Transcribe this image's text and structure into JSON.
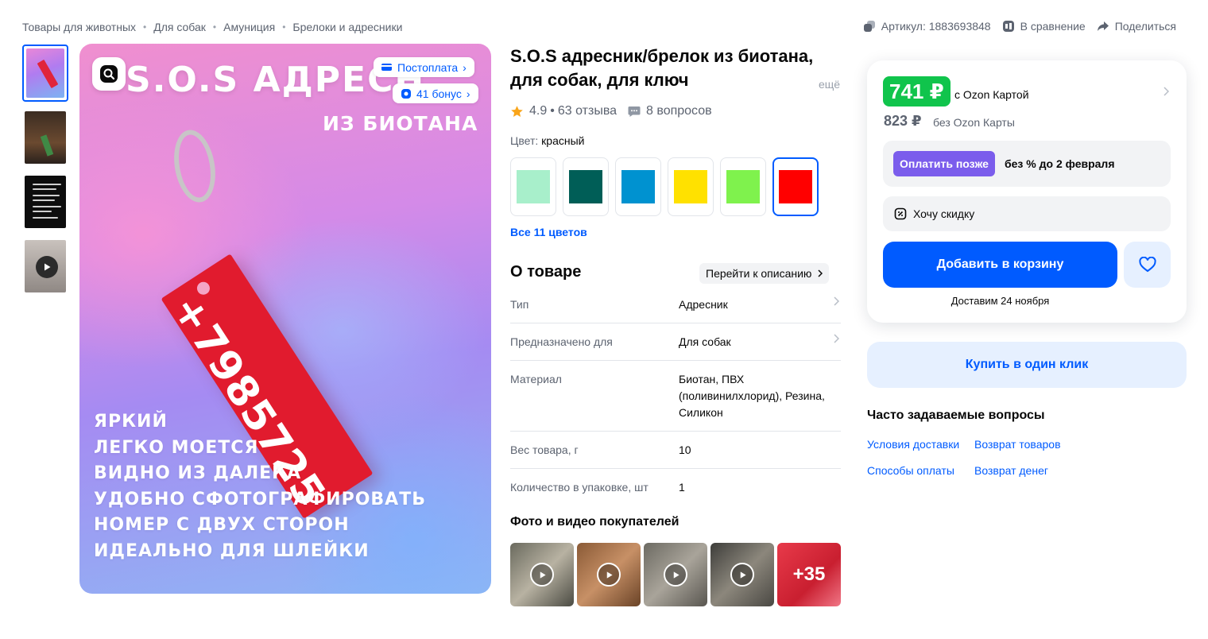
{
  "breadcrumb": [
    "Товары для животных",
    "Для собак",
    "Амуниция",
    "Брелоки и адресники"
  ],
  "top_actions": {
    "article": "Артикул: 1883693848",
    "compare": "В сравнение",
    "share": "Поделиться"
  },
  "image": {
    "title_line1": "S.O.S АДРЕСН",
    "title_line2": "ИЗ БИОТАНА",
    "badge_postpay": "Постоплата",
    "badge_bonus": "41 бонус",
    "tag_text": "+7985725",
    "features": [
      "ЯРКИЙ",
      "ЛЕГКО МОЕТСЯ",
      "ВИДНО ИЗ ДАЛЕКА",
      "УДОБНО СФОТОГРАФИРОВАТЬ",
      "НОМЕР С ДВУХ СТОРОН",
      "ИДЕАЛЬНО ДЛЯ ШЛЕЙКИ"
    ]
  },
  "product": {
    "title": "S.O.S адресник/брелок из биотана, для собак, для ключ",
    "more": "ещё",
    "rating": "4.9",
    "reviews": "63 отзыва",
    "questions": "8 вопросов",
    "color_label": "Цвет:",
    "color_value": "красный",
    "swatch_colors": [
      "#a8efcb",
      "#005e57",
      "#0092d0",
      "#ffe100",
      "#7ff24d",
      "#ff0000"
    ],
    "all_colors": "Все 11 цветов"
  },
  "about": {
    "heading": "О товаре",
    "goto_label": "Перейти к описанию",
    "specs": [
      {
        "key": "Тип",
        "value": "Адресник"
      },
      {
        "key": "Предназначено для",
        "value": "Для собак"
      },
      {
        "key": "Материал",
        "value": "Биотан, ПВХ (поливинилхлорид), Резина, Силикон"
      },
      {
        "key": "Вес товара, г",
        "value": "10"
      },
      {
        "key": "Количество в упаковке, шт",
        "value": "1"
      }
    ]
  },
  "photos": {
    "heading": "Фото и видео покупателей",
    "more_count": "+35"
  },
  "buy": {
    "price": "741 ₽",
    "price_label": "с Ozon Картой",
    "old_price": "823 ₽",
    "old_price_label": "без Ozon Карты",
    "pay_later_button": "Оплатить позже",
    "pay_later_text": "без % до 2 февраля",
    "discount": "Хочу скидку",
    "add_to_cart": "Добавить в корзину",
    "delivery": "Доставим 24 ноября",
    "one_click": "Купить в один клик"
  },
  "faq": {
    "heading": "Часто задаваемые вопросы",
    "links": [
      "Условия доставки",
      "Возврат товаров",
      "Способы оплаты",
      "Возврат денег"
    ]
  },
  "colors": {
    "accent": "#005bff",
    "price_green": "#10c44c",
    "pay_later": "#7b5dec",
    "star": "#f9a51a"
  }
}
